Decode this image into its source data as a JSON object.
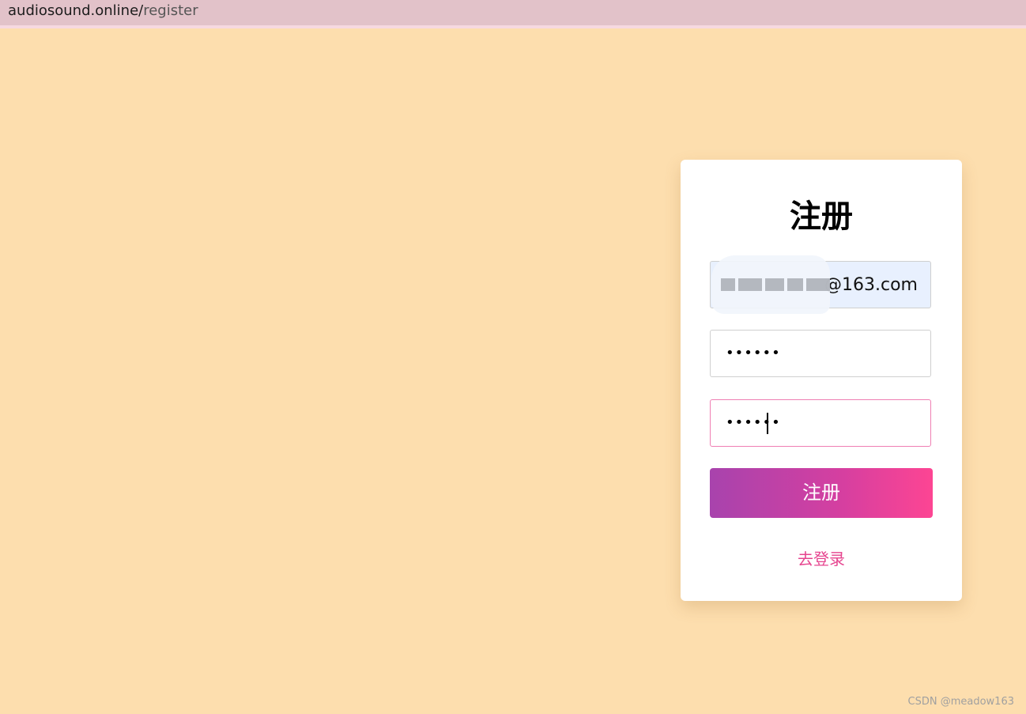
{
  "browser": {
    "url_host": "audiosound.online/",
    "url_path": "register"
  },
  "register_form": {
    "title": "注册",
    "email_value": "@163.com",
    "password_mask": "••••••",
    "confirm_mask": "••••••",
    "submit_label": "注册",
    "login_link_label": "去登录"
  },
  "watermark": "CSDN @meadow163",
  "colors": {
    "page_background": "#fddeae",
    "button_gradient_start": "#a843ad",
    "button_gradient_end": "#fd4593",
    "link": "#e6458f"
  }
}
